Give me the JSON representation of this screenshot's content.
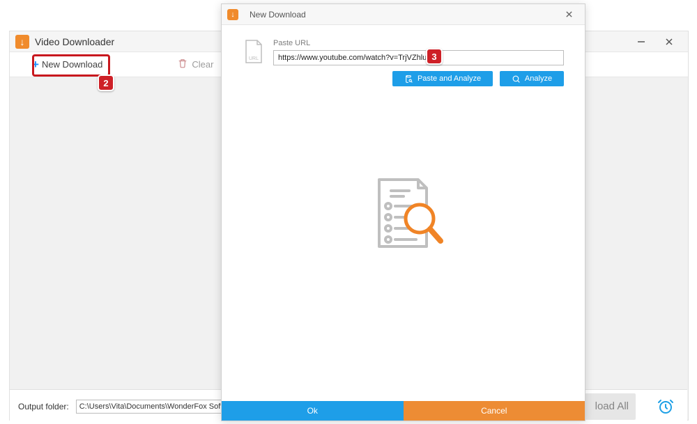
{
  "main": {
    "title": "Video Downloader",
    "toolbar": {
      "new_download_label": "New Download",
      "clear_label": "Clear"
    },
    "callouts": {
      "badge2": "2",
      "badge3": "3"
    },
    "bottom": {
      "output_label": "Output folder:",
      "output_path": "C:\\Users\\Vita\\Documents\\WonderFox Soft\\HD Vid",
      "download_all_label": "load All"
    }
  },
  "dialog": {
    "title": "New Download",
    "paste_url_label": "Paste URL",
    "url_value": "https://www.youtube.com/watch?v=TrjVZhluzdw",
    "paste_analyze_label": "Paste and Analyze",
    "analyze_label": "Analyze",
    "ok_label": "Ok",
    "cancel_label": "Cancel"
  }
}
